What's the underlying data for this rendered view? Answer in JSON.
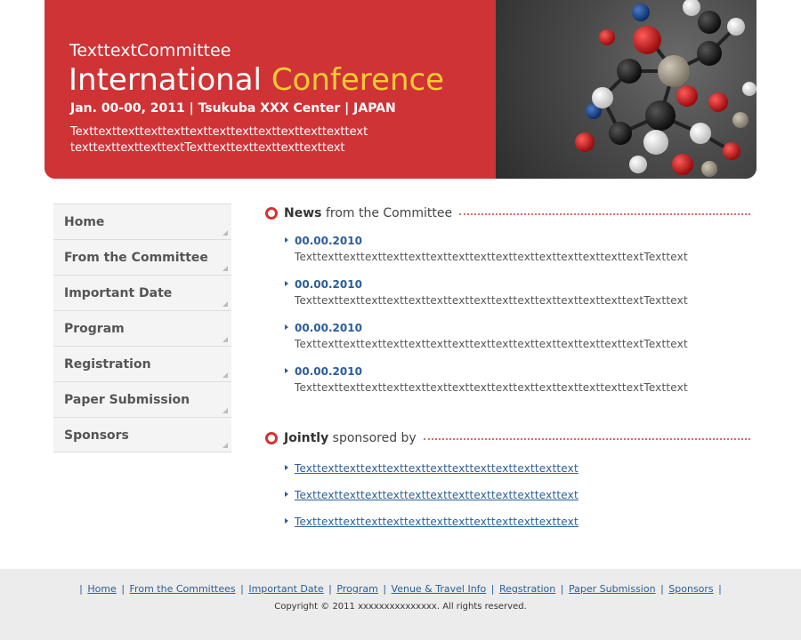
{
  "banner": {
    "committee": "TexttextCommittee",
    "title_part1": "International",
    "title_part2": "Conference",
    "date_line": "Jan. 00-00, 2011 | Tsukuba XXX Center | JAPAN",
    "desc_line1": "Texttexttexttexttexttexttexttexttexttexttexttexttext",
    "desc_line2": "texttexttexttexttextTexttexttexttexttexttexttext",
    "colors": {
      "red": "#cf3336",
      "highlight": "#ffcc33"
    }
  },
  "sidebar": {
    "items": [
      {
        "label": "Home"
      },
      {
        "label": "From the Committee"
      },
      {
        "label": "Important Date"
      },
      {
        "label": "Program"
      },
      {
        "label": "Registration"
      },
      {
        "label": "Paper Submission"
      },
      {
        "label": "Sponsors"
      }
    ]
  },
  "news": {
    "title_bold": "News",
    "title_rest": "from the Committee",
    "items": [
      {
        "date": "00.00.2010",
        "text": "TexttexttexttexttexttexttexttexttexttexttexttexttexttexttexttextTexttext"
      },
      {
        "date": "00.00.2010",
        "text": "TexttexttexttexttexttexttexttexttexttexttexttexttexttexttexttextTexttext"
      },
      {
        "date": "00.00.2010",
        "text": "TexttexttexttexttexttexttexttexttexttexttexttexttexttexttexttextTexttext"
      },
      {
        "date": "00.00.2010",
        "text": "TexttexttexttexttexttexttexttexttexttexttexttexttexttexttexttextTexttext"
      }
    ]
  },
  "sponsors": {
    "title_bold": "Jointly",
    "title_rest": "sponsored by",
    "items": [
      {
        "label": "Texttexttexttexttexttexttexttexttexttexttexttexttext"
      },
      {
        "label": "Texttexttexttexttexttexttexttexttexttexttexttexttext"
      },
      {
        "label": "Texttexttexttexttexttexttexttexttexttexttexttexttext"
      }
    ]
  },
  "footer": {
    "links": [
      {
        "label": "Home"
      },
      {
        "label": "From the Committees"
      },
      {
        "label": "Important Date"
      },
      {
        "label": "Program"
      },
      {
        "label": "Venue & Travel Info"
      },
      {
        "label": "Regstration"
      },
      {
        "label": "Paper Submission"
      },
      {
        "label": "Sponsors"
      }
    ],
    "copyright": "Copyright © 2011 xxxxxxxxxxxxxxx. All rights reserved."
  }
}
